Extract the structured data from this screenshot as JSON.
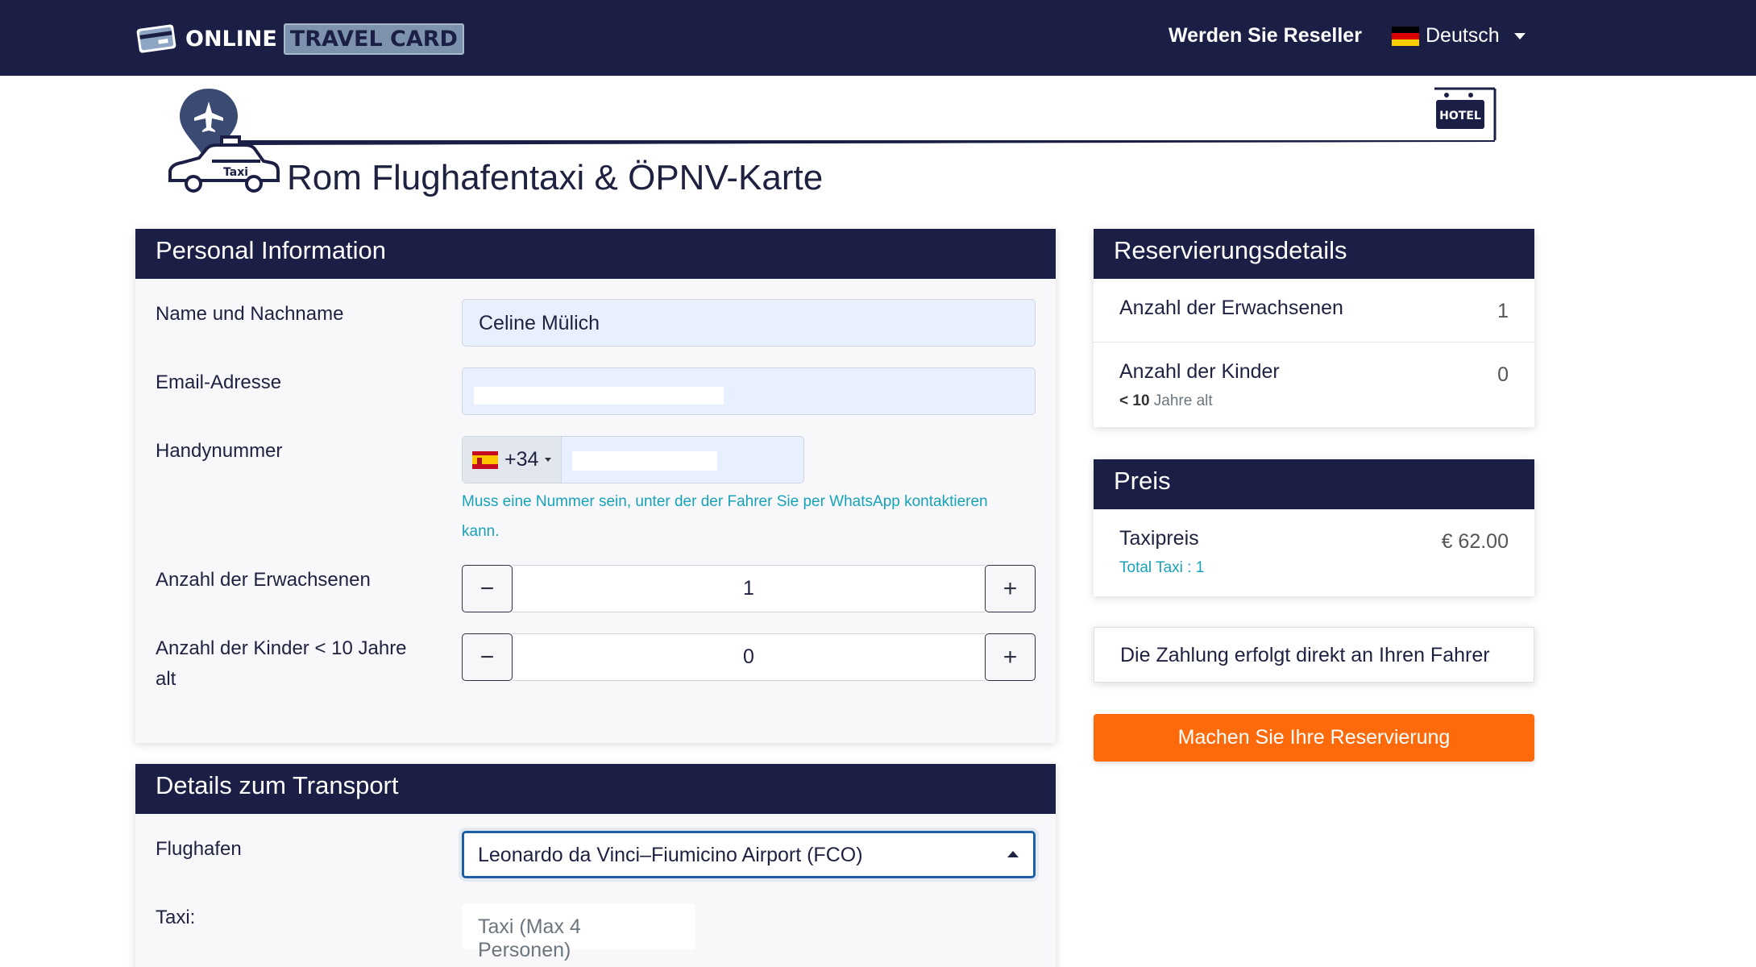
{
  "brand": {
    "logo_part1": "ONLINE",
    "logo_part2": "TRAVEL CARD"
  },
  "nav": {
    "reseller": "Werden Sie Reseller",
    "language": "Deutsch",
    "language_flag": "germany-flag-icon"
  },
  "hero": {
    "title": "Rom Flughafentaxi & ÖPNV-Karte",
    "taxi_sign": "Taxi",
    "hotel_sign": "HOTEL"
  },
  "personal": {
    "header": "Personal Information",
    "name_label": "Name und Nachname",
    "name_value": "Celine Mülich",
    "email_label": "Email-Adresse",
    "email_value": "",
    "phone_label": "Handynummer",
    "phone_dial_code": "+34",
    "phone_flag": "spain-flag-icon",
    "phone_help": "Muss eine Nummer sein, unter der der Fahrer Sie per WhatsApp kontaktieren kann.",
    "adults_label": "Anzahl der Erwachsenen",
    "adults_value": "1",
    "children_label": "Anzahl der Kinder < 10 Jahre alt",
    "children_value": "0",
    "minus": "−",
    "plus": "+"
  },
  "transport": {
    "header": "Details zum Transport",
    "airport_label": "Flughafen",
    "airport_value": "Leonardo da Vinci–Fiumicino Airport (FCO)",
    "taxi_label": "Taxi:",
    "taxi_value": "Taxi (Max 4 Personen)"
  },
  "reservation": {
    "header": "Reservierungsdetails",
    "adults_label": "Anzahl der Erwachsenen",
    "adults_value": "1",
    "children_label": "Anzahl der Kinder",
    "children_value": "0",
    "children_sub_prefix": "< 10",
    "children_sub_suffix": "Jahre alt"
  },
  "price": {
    "header": "Preis",
    "taxi_label": "Taxipreis",
    "taxi_value": "€ 62.00",
    "taxi_sub": "Total Taxi : 1"
  },
  "payment_note": "Die Zahlung erfolgt direkt an Ihren Fahrer",
  "reserve_button": "Machen Sie Ihre Reservierung",
  "colors": {
    "navy": "#1b1f45",
    "accent_orange": "#fd6a0b",
    "teal_text": "#17a2b8",
    "input_bg": "#e8f0fe"
  }
}
